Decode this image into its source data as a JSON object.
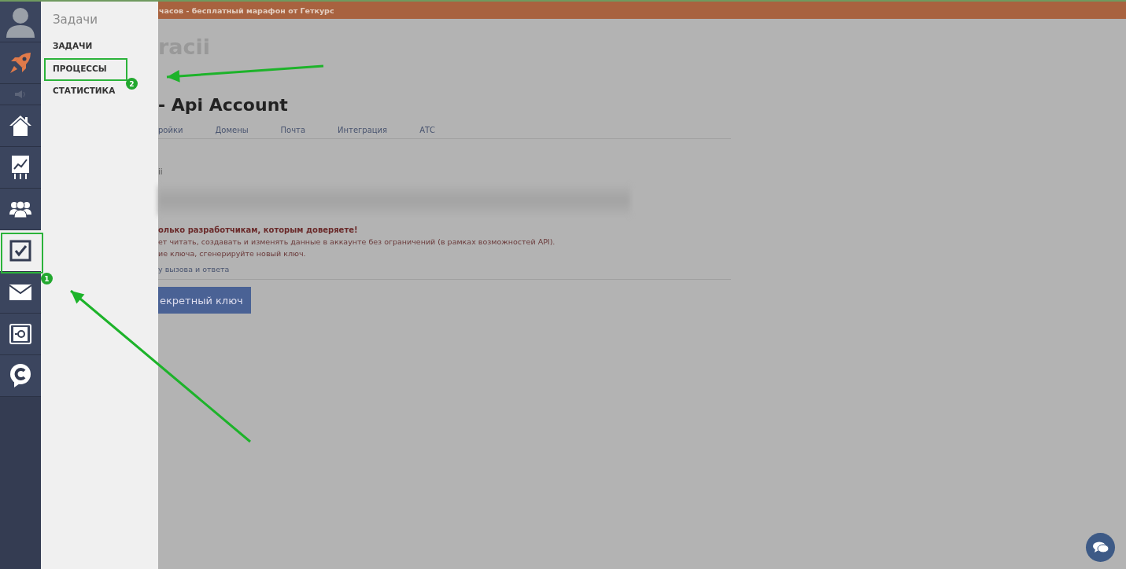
{
  "banner": {
    "text": "часов - бесплатный марафон от Геткурс"
  },
  "sidebar": {
    "items": [
      {
        "kind": "avatar",
        "selected": false
      },
      {
        "kind": "rocket",
        "selected": false
      },
      {
        "kind": "speaker",
        "selected": false
      },
      {
        "kind": "home",
        "selected": false
      },
      {
        "kind": "chart",
        "selected": false
      },
      {
        "kind": "users",
        "selected": false
      },
      {
        "kind": "tasks",
        "selected": true
      },
      {
        "kind": "mail",
        "selected": false
      },
      {
        "kind": "safe",
        "selected": false
      },
      {
        "kind": "chat",
        "selected": false
      }
    ]
  },
  "flyout": {
    "title": "Задачи",
    "items": [
      {
        "label": "ЗАДАЧИ"
      },
      {
        "label": "ПРОЦЕССЫ"
      },
      {
        "label": "СТАТИСТИКА"
      }
    ]
  },
  "page": {
    "heading": "racii",
    "subheading": "- Api Account",
    "tabs": [
      {
        "label": "ройки"
      },
      {
        "label": "Домены"
      },
      {
        "label": "Почта"
      },
      {
        "label": "Интеграция"
      },
      {
        "label": "АТС"
      }
    ],
    "field_label": "ii",
    "warning": "олько разработчикам, которым доверяете!",
    "lines": [
      "ет читать, создавать и изменять данные в аккаунте без ограничений (в рамках возможностей API).",
      "ие ключа, сгенерируйте новый ключ."
    ],
    "link": "у вызова и ответа",
    "button": "екретный ключ"
  },
  "annotations": [
    {
      "kind": "sidebar",
      "badge": "1"
    },
    {
      "kind": "flyout",
      "badge": "2"
    }
  ]
}
